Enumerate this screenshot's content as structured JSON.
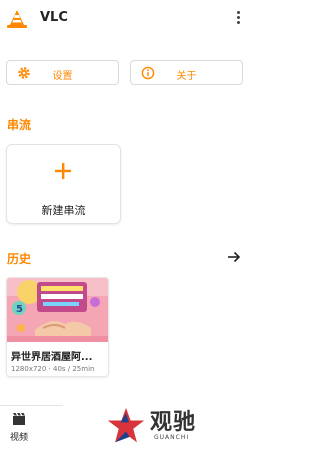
{
  "app": {
    "title": "VLC"
  },
  "icons": {
    "logo": "vlc-cone-icon",
    "more": "more-vertical-icon",
    "settings": "gear-icon",
    "about": "info-icon",
    "add": "plus-icon",
    "forward": "arrow-right-icon",
    "video": "film-icon"
  },
  "colors": {
    "accent": "#ff8800",
    "text": "#222222"
  },
  "actions": {
    "settings_label": "设置",
    "about_label": "关于"
  },
  "stream": {
    "section_title": "串流",
    "new_stream_label": "新建串流"
  },
  "history": {
    "section_title": "历史",
    "items": [
      {
        "title": "异世界居酒屋阿...",
        "meta": "1280x720 · 40s / 25min"
      }
    ]
  },
  "bottom_nav": {
    "video_label": "视频"
  },
  "watermark": {
    "cn": "观驰",
    "en": "GUANCHI"
  }
}
